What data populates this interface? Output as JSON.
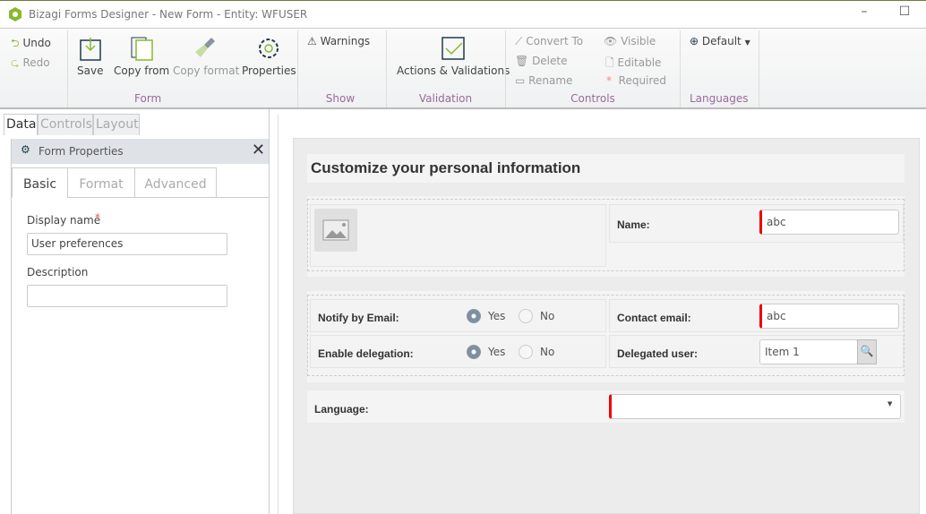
{
  "window": {
    "title": "Bizagi Forms Designer  - New Form - Entity:  WFUSER",
    "minimize": "–",
    "maximize": "☐"
  },
  "ribbon": {
    "undo": "Undo",
    "redo": "Redo",
    "save": "Save",
    "copy_from": "Copy from",
    "copy_format": "Copy format",
    "properties": "Properties",
    "form_group": "Form",
    "warnings": "Warnings",
    "show_group": "Show",
    "actions": "Actions & Validations",
    "validation_group": "Validation",
    "convert_to": "Convert To",
    "delete": "Delete",
    "rename": "Rename",
    "visible": "Visible",
    "editable": "Editable",
    "required": "Required",
    "controls_group": "Controls",
    "language": "Default",
    "languages_group": "Languages"
  },
  "left": {
    "tabs": [
      "Data",
      "Controls",
      "Layout"
    ],
    "panel": {
      "title": "Form Properties",
      "tabs": [
        "Basic",
        "Format",
        "Advanced"
      ],
      "display_name_label": "Display name",
      "required_mark": "*",
      "display_name_value": "User preferences",
      "description_label": "Description",
      "description_value": ""
    }
  },
  "form": {
    "title": "Customize your personal information",
    "name_label": "Name:",
    "name_value": "abc",
    "notify_label": "Notify by Email:",
    "notify_value": "Yes",
    "contact_label": "Contact email:",
    "contact_value": "abc",
    "delegation_label": "Enable delegation:",
    "delegation_value": "Yes",
    "delegated_label": "Delegated user:",
    "delegated_value": "Item 1",
    "yes": "Yes",
    "no": "No",
    "language_label": "Language:",
    "language_value": ""
  },
  "colors": {
    "accent": "#8ab82e",
    "required": "#e00000",
    "group_label": "#9a6a9a"
  }
}
